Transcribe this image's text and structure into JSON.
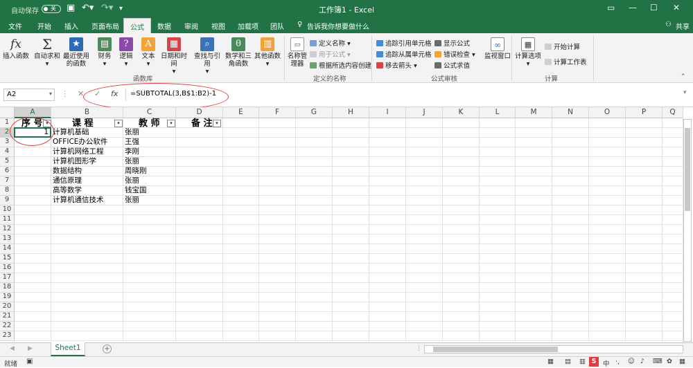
{
  "titlebar": {
    "autosave_label": "自动保存",
    "autosave_state": "关",
    "title": "工作簿1 - Excel",
    "save_icon": "save-icon",
    "undo_icon": "undo-icon",
    "redo_icon": "redo-icon"
  },
  "tabs": [
    "文件",
    "开始",
    "插入",
    "页面布局",
    "公式",
    "数据",
    "审阅",
    "视图",
    "加载项",
    "团队"
  ],
  "active_tab": "公式",
  "tellme": "告诉我你想要做什么",
  "share": "共享",
  "ribbon": {
    "function_library": {
      "label": "函数库",
      "insert_function": "插入函数",
      "autosum": "自动求和",
      "recent": "最近使用的函数",
      "financial": "财务",
      "logical": "逻辑",
      "text": "文本",
      "datetime": "日期和时间",
      "lookup": "查找与引用",
      "math": "数学和三角函数",
      "more": "其他函数"
    },
    "defined_names": {
      "label": "定义的名称",
      "name_manager": "名称管理器",
      "define_name": "定义名称",
      "use_in_formula": "用于公式",
      "create_from_selection": "根据所选内容创建"
    },
    "formula_auditing": {
      "label": "公式审核",
      "trace_precedents": "追踪引用单元格",
      "trace_dependents": "追踪从属单元格",
      "remove_arrows": "移去箭头",
      "show_formulas": "显示公式",
      "error_checking": "错误检查",
      "evaluate_formula": "公式求值",
      "watch_window": "监视窗口"
    },
    "calculation": {
      "label": "计算",
      "calc_options": "计算选项",
      "calc_now": "开始计算",
      "calc_sheet": "计算工作表"
    }
  },
  "formula_bar": {
    "name_box": "A2",
    "formula": "=SUBTOTAL(3,B$1:B2)-1",
    "fx": "fx"
  },
  "columns": [
    "A",
    "B",
    "C",
    "D",
    "E",
    "F",
    "G",
    "H",
    "I",
    "J",
    "K",
    "L",
    "M",
    "N",
    "O",
    "P",
    "Q"
  ],
  "rows": [
    "1",
    "2",
    "3",
    "4",
    "5",
    "6",
    "7",
    "8",
    "9",
    "10",
    "11",
    "12",
    "13",
    "14",
    "15",
    "16",
    "17",
    "18",
    "19",
    "20",
    "21",
    "22",
    "23"
  ],
  "table": {
    "headers": [
      "序号",
      "课程",
      "教师",
      "备注"
    ],
    "header_display": [
      "序 号",
      "课 程",
      "教 师",
      "备 注"
    ],
    "rows": [
      {
        "seq": "1",
        "course": "计算机基础",
        "teacher": "张丽"
      },
      {
        "seq": "",
        "course": "OFFICE办公软件",
        "teacher": "王强"
      },
      {
        "seq": "",
        "course": "计算机网络工程",
        "teacher": "李刚"
      },
      {
        "seq": "",
        "course": "计算机图形学",
        "teacher": "张丽"
      },
      {
        "seq": "",
        "course": "数据结构",
        "teacher": "周晓刚"
      },
      {
        "seq": "",
        "course": "通信原理",
        "teacher": "张丽"
      },
      {
        "seq": "",
        "course": "高等数学",
        "teacher": "钱宝国"
      },
      {
        "seq": "",
        "course": "计算机通信技术",
        "teacher": "张丽"
      }
    ]
  },
  "sheet_tab": "Sheet1",
  "status": {
    "ready": "就绪"
  },
  "colors": {
    "excel_green": "#217346",
    "annotation_red": "#e23c3c"
  }
}
